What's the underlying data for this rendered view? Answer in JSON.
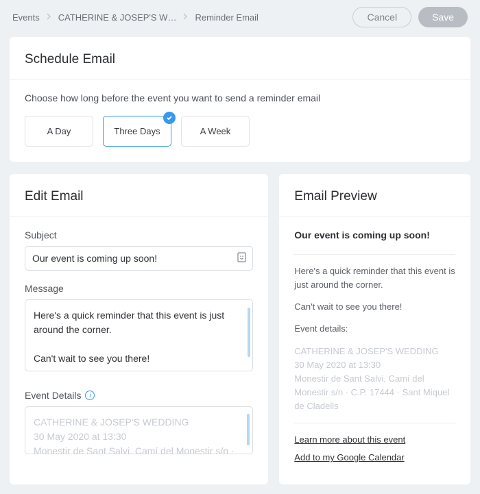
{
  "breadcrumbs": [
    "Events",
    "CATHERINE & JOSEP'S W…",
    "Reminder Email"
  ],
  "header": {
    "cancel": "Cancel",
    "save": "Save"
  },
  "schedule": {
    "title": "Schedule Email",
    "intro": "Choose how long before the event you want to send a reminder email",
    "options": [
      {
        "label": "A Day",
        "selected": false
      },
      {
        "label": "Three Days",
        "selected": true
      },
      {
        "label": "A Week",
        "selected": false
      }
    ]
  },
  "edit": {
    "title": "Edit Email",
    "subject_label": "Subject",
    "subject_value": "Our event is coming up soon!",
    "message_label": "Message",
    "message_value": "Here's a quick reminder that this event is just around the corner.\n\nCan't wait to see you there!",
    "details_label": "Event Details",
    "details_value": "CATHERINE & JOSEP'S WEDDING\n30 May 2020 at 13:30\nMonestir de Sant Salvi, Camí del Monestir s/n · C.P."
  },
  "preview": {
    "title": "Email Preview",
    "subject": "Our event is coming up soon!",
    "body1": "Here's a quick reminder that this event is just around the corner.",
    "body2": "Can't wait to see you there!",
    "details_heading": "Event details:",
    "details_line1": "CATHERINE & JOSEP'S WEDDING",
    "details_line2": "30 May 2020 at 13:30",
    "details_line3": "Monestir de Sant Salvi, Camí del Monestir s/n · C.P. 17444 · Sant Miquel de Cladells",
    "link1": "Learn more about this event",
    "link2": "Add to my Google Calendar"
  }
}
